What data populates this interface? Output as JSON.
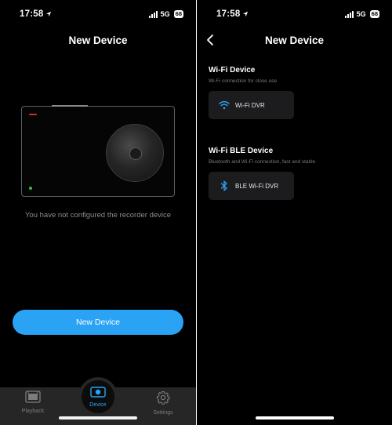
{
  "status": {
    "time": "17:58",
    "network": "5G",
    "battery": "68"
  },
  "left": {
    "title": "New Device",
    "empty_message": "You have not configured the recorder device",
    "new_device_button": "New Device",
    "tabs": [
      {
        "label": "Playback",
        "icon": "playback-icon"
      },
      {
        "label": "Device",
        "icon": "device-icon",
        "active": true
      },
      {
        "label": "Settings",
        "icon": "settings-gear-icon"
      }
    ]
  },
  "right": {
    "title": "New Device",
    "sections": [
      {
        "title": "Wi-Fi Device",
        "subtitle": "Wi-Fi connection for close use",
        "option_label": "Wi-Fi DVR",
        "icon": "wifi-icon"
      },
      {
        "title": "Wi-Fi BLE Device",
        "subtitle": "Bluetooth and Wi-Fi connection, fast and stable",
        "option_label": "BLE Wi-Fi DVR",
        "icon": "bluetooth-icon"
      }
    ]
  },
  "colors": {
    "accent": "#2aa3f5",
    "background": "#000000",
    "tab_bar": "#262626",
    "card": "#1c1c1e"
  }
}
